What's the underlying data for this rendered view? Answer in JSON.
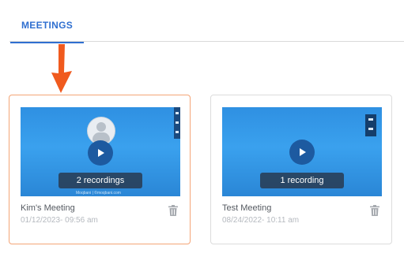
{
  "tabs": {
    "active_label": "MEETINGS"
  },
  "colors": {
    "accent": "#2f6fd0",
    "highlight_border": "#f4a577",
    "arrow": "#f05a1e"
  },
  "meetings": [
    {
      "title": "Kim's Meeting",
      "date": "01/12/2023- 09:56 am",
      "recordings_label": "2 recordings",
      "thumbnail_logo_text": "Moqbani | ©moqbani.com"
    },
    {
      "title": "Test Meeting",
      "date": "08/24/2022- 10:11 am",
      "recordings_label": "1 recording"
    }
  ],
  "icons": [
    "play-icon",
    "trash-icon",
    "user-avatar-icon",
    "arrow-annotation-icon"
  ]
}
